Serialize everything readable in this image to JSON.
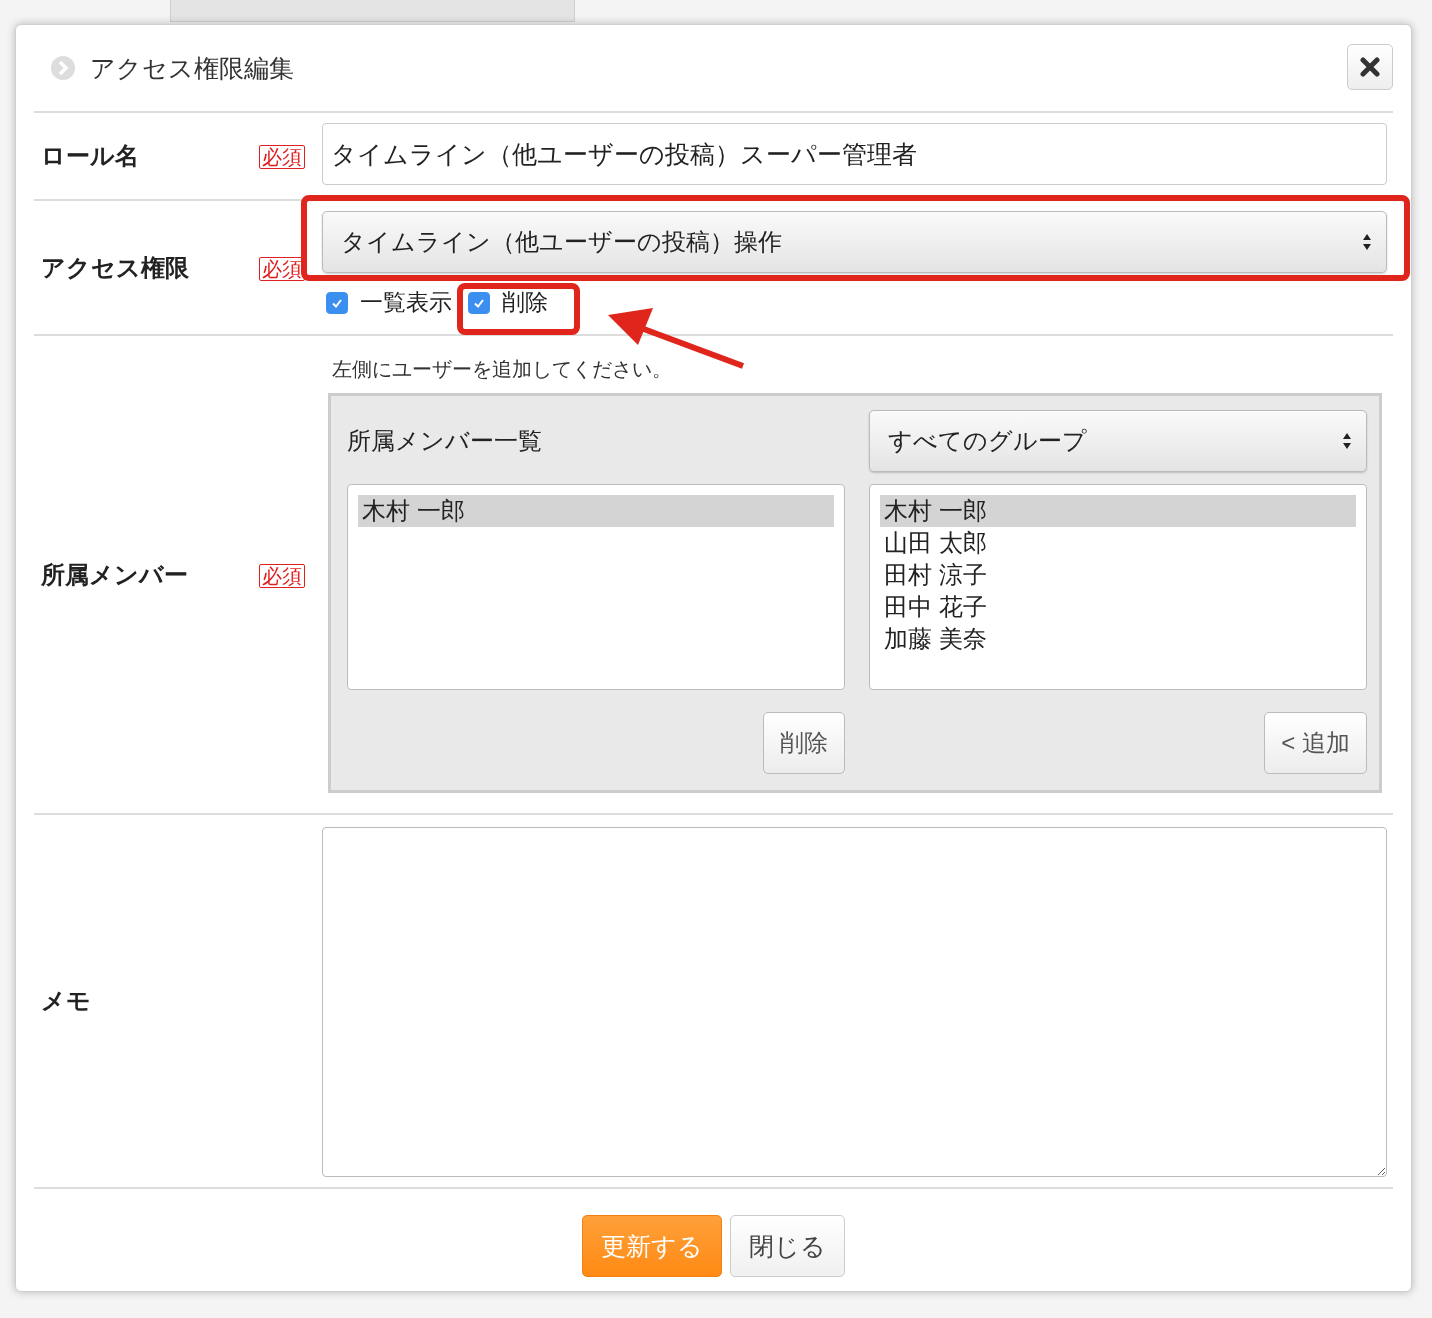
{
  "dialog": {
    "title": "アクセス権限編集"
  },
  "role_name": {
    "label": "ロール名",
    "badge": "必須",
    "value": "タイムライン（他ユーザーの投稿）スーパー管理者"
  },
  "access": {
    "label": "アクセス権限",
    "badge": "必須",
    "select": "タイムライン（他ユーザーの投稿）操作",
    "permissions": [
      {
        "label": "一覧表示",
        "checked": true
      },
      {
        "label": "削除",
        "checked": true
      }
    ]
  },
  "members": {
    "label": "所属メンバー",
    "badge": "必須",
    "hint": "左側にユーザーを追加してください。",
    "list_title": "所属メンバー一覧",
    "group_select": "すべてのグループ",
    "selected_members": [
      {
        "name": "木村 一郎",
        "selected": true
      }
    ],
    "candidates": [
      {
        "name": "木村 一郎",
        "selected": true
      },
      {
        "name": "山田 太郎",
        "selected": false
      },
      {
        "name": "田村 涼子",
        "selected": false
      },
      {
        "name": "田中 花子",
        "selected": false
      },
      {
        "name": "加藤 美奈",
        "selected": false
      }
    ],
    "remove_button": "削除",
    "add_button": "< 追加"
  },
  "memo": {
    "label": "メモ"
  },
  "buttons": [
    {
      "label": "更新する",
      "kind": "primary"
    },
    {
      "label": "閉じる",
      "kind": "default"
    }
  ],
  "annotations": [
    {
      "kind": "box"
    },
    {
      "kind": "box"
    },
    {
      "kind": "arrow"
    }
  ]
}
